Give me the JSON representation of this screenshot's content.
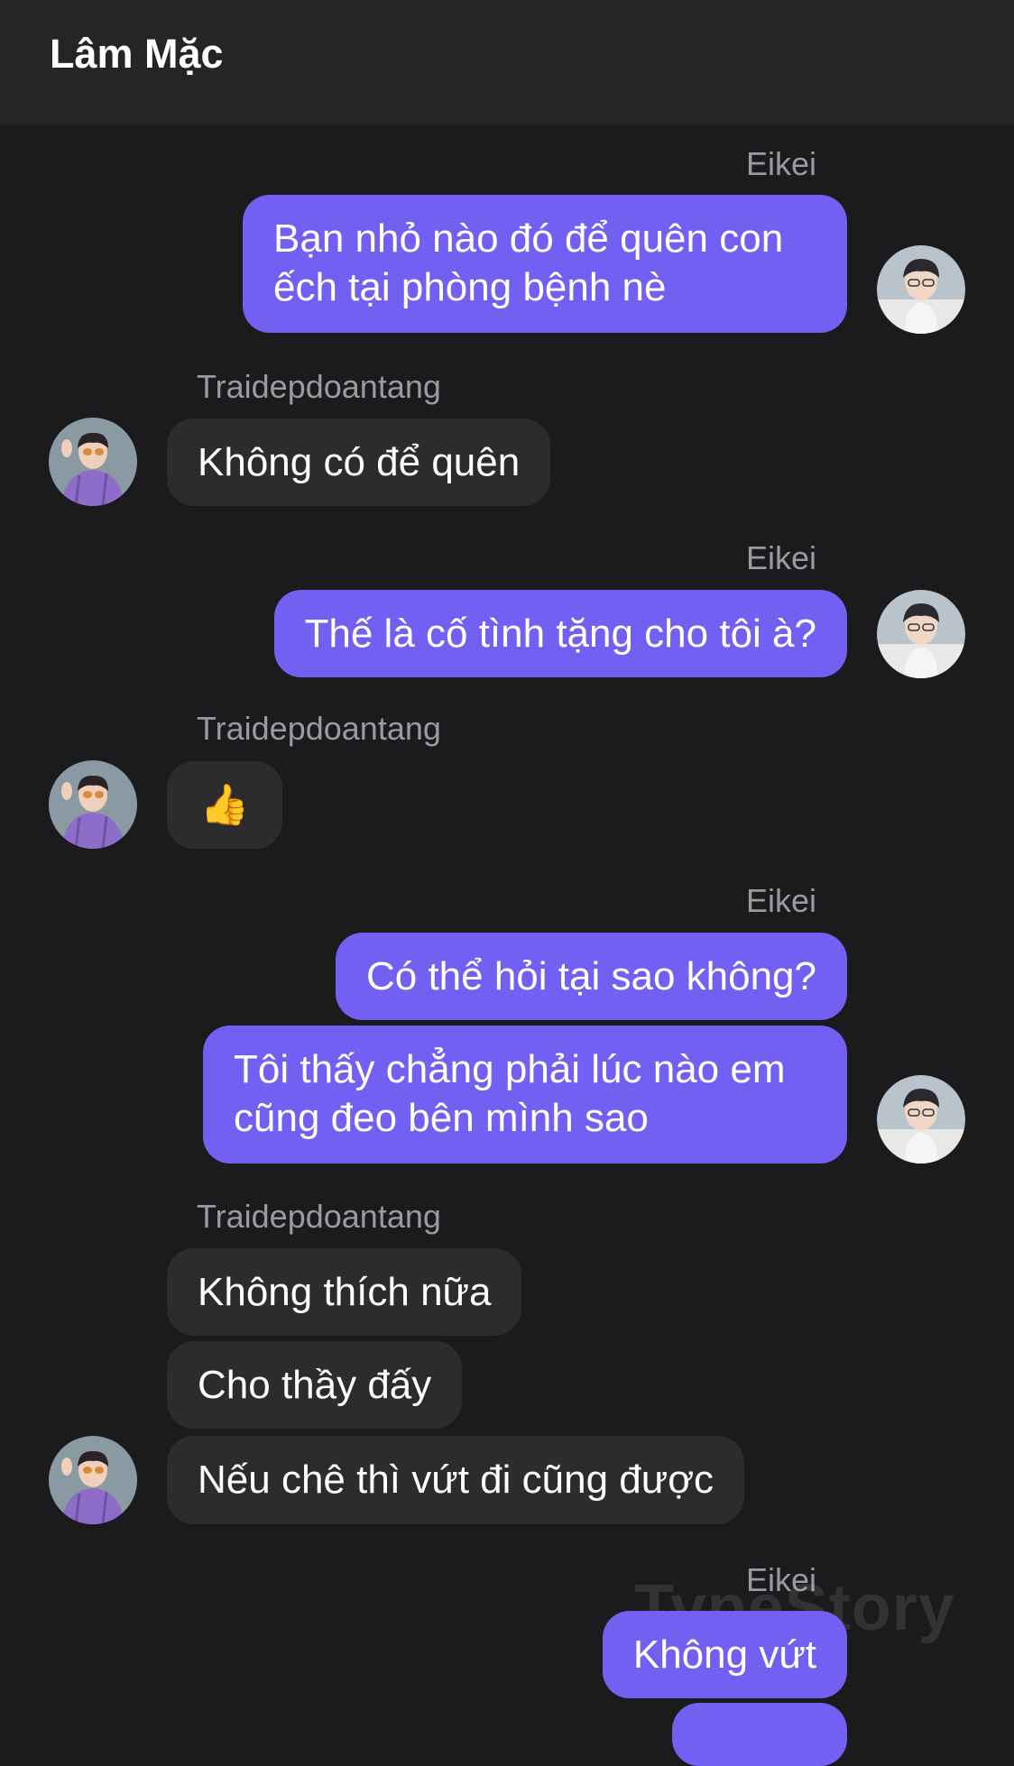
{
  "header": {
    "title": "Lâm Mặc"
  },
  "messages": {
    "m1_sender": "Eikei",
    "m1_text_l1": "Bạn nhỏ nào đó để quên con",
    "m1_text_l2": "ếch tại phòng bệnh nè",
    "m2_sender": "Traidepdoantang",
    "m2_text": "Không có để quên",
    "m3_sender": "Eikei",
    "m3_text": "Thế là cố tình tặng cho tôi à?",
    "m4_sender": "Traidepdoantang",
    "m4_text": "👍",
    "m5_sender": "Eikei",
    "m5_text": "Có thể hỏi tại sao không?",
    "m6_text_l1": "Tôi thấy chẳng phải lúc nào em",
    "m6_text_l2": "cũng đeo bên mình sao",
    "m7_sender": "Traidepdoantang",
    "m7_text": "Không thích nữa",
    "m8_text": "Cho thầy đấy",
    "m9_text": "Nếu chê thì vứt đi cũng được",
    "m10_sender": "Eikei",
    "m10_text": "Không vứt"
  },
  "watermark": "TypeStory",
  "colors": {
    "outgoing": "#7360f2",
    "incoming": "#2c2c2e",
    "background": "#1b1b1d"
  }
}
